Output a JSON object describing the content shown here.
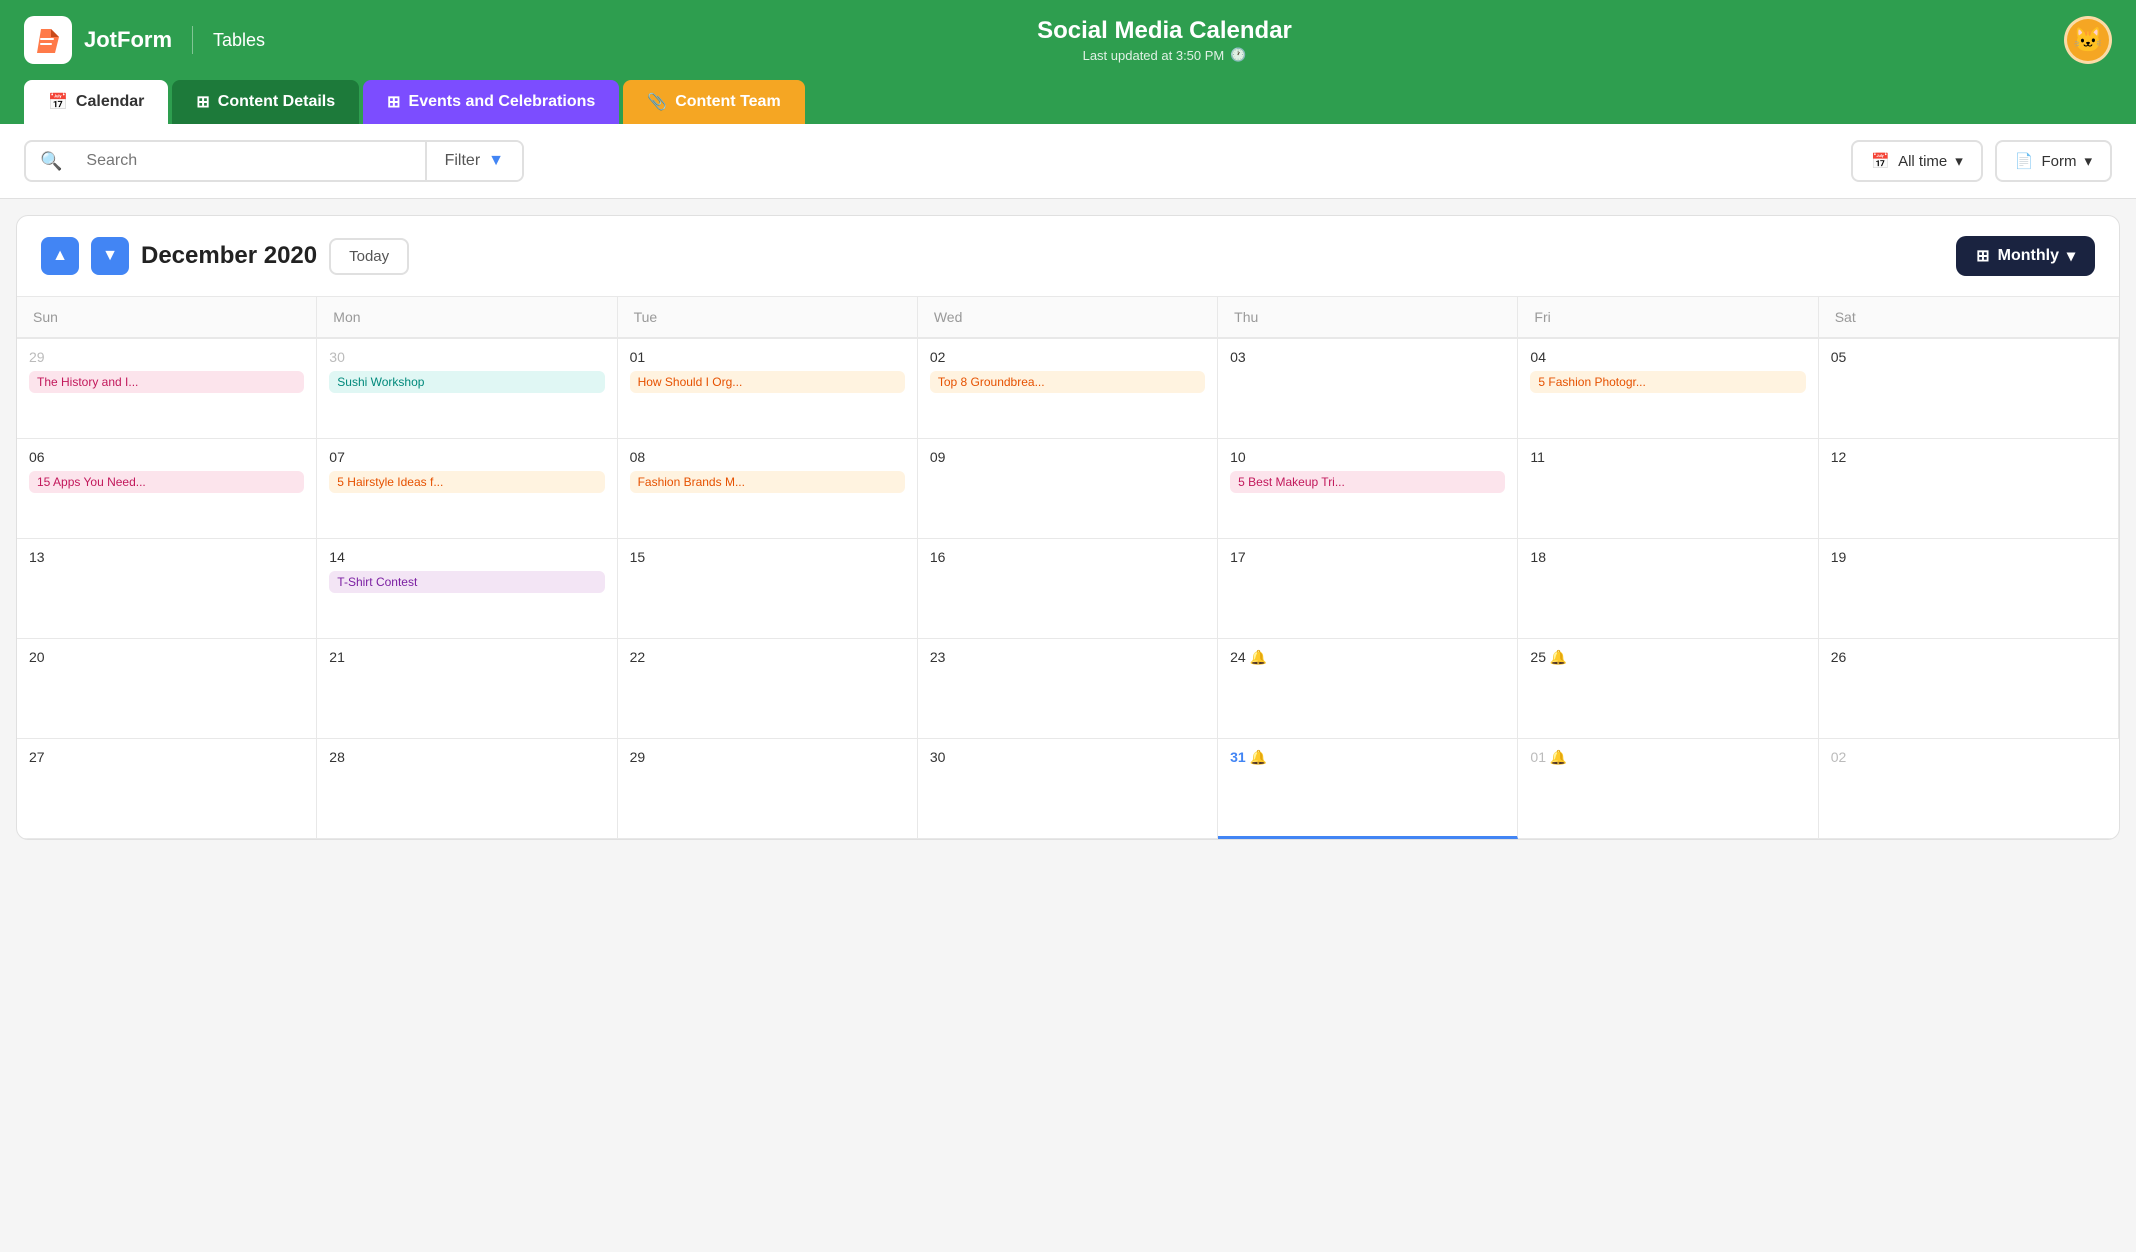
{
  "header": {
    "logo_text": "JotForm",
    "tables_label": "Tables",
    "title": "Social Media Calendar",
    "subtitle": "Last updated at 3:50 PM",
    "avatar_emoji": "🐱"
  },
  "tabs": [
    {
      "id": "calendar",
      "label": "Calendar",
      "icon": "📅",
      "active": true
    },
    {
      "id": "content-details",
      "label": "Content Details",
      "icon": "📊",
      "active": false
    },
    {
      "id": "events",
      "label": "Events and Celebrations",
      "icon": "📊",
      "active": false
    },
    {
      "id": "content-team",
      "label": "Content Team",
      "icon": "📎",
      "active": false
    }
  ],
  "toolbar": {
    "search_placeholder": "Search",
    "filter_label": "Filter",
    "all_time_label": "All time",
    "form_label": "Form"
  },
  "calendar": {
    "prev_label": "▲",
    "next_label": "▼",
    "month_title": "December 2020",
    "today_label": "Today",
    "view_label": "Monthly",
    "day_headers": [
      "Sun",
      "Mon",
      "Tue",
      "Wed",
      "Thu",
      "Fri",
      "Sat"
    ],
    "weeks": [
      [
        {
          "num": "29",
          "muted": true,
          "events": [
            {
              "label": "The History and I...",
              "style": "pink"
            }
          ]
        },
        {
          "num": "30",
          "muted": true,
          "events": [
            {
              "label": "Sushi Workshop",
              "style": "teal"
            }
          ]
        },
        {
          "num": "01",
          "events": [
            {
              "label": "How Should I Org...",
              "style": "orange"
            }
          ]
        },
        {
          "num": "02",
          "events": [
            {
              "label": "Top 8 Groundbrea...",
              "style": "orange"
            }
          ]
        },
        {
          "num": "03",
          "events": []
        },
        {
          "num": "04",
          "events": [
            {
              "label": "5 Fashion Photogr...",
              "style": "orange"
            }
          ]
        },
        {
          "num": "05",
          "events": []
        }
      ],
      [
        {
          "num": "06",
          "events": [
            {
              "label": "15 Apps You Need...",
              "style": "pink"
            }
          ]
        },
        {
          "num": "07",
          "events": [
            {
              "label": "5 Hairstyle Ideas f...",
              "style": "orange"
            }
          ]
        },
        {
          "num": "08",
          "events": [
            {
              "label": "Fashion Brands M...",
              "style": "orange"
            }
          ]
        },
        {
          "num": "09",
          "events": []
        },
        {
          "num": "10",
          "events": [
            {
              "label": "5 Best Makeup Tri...",
              "style": "pink"
            }
          ]
        },
        {
          "num": "11",
          "events": []
        },
        {
          "num": "12",
          "events": []
        }
      ],
      [
        {
          "num": "13",
          "events": []
        },
        {
          "num": "14",
          "events": [
            {
              "label": "T-Shirt Contest",
              "style": "purple"
            }
          ]
        },
        {
          "num": "15",
          "events": []
        },
        {
          "num": "16",
          "events": []
        },
        {
          "num": "17",
          "events": []
        },
        {
          "num": "18",
          "events": []
        },
        {
          "num": "19",
          "events": []
        }
      ],
      [
        {
          "num": "20",
          "events": []
        },
        {
          "num": "21",
          "events": []
        },
        {
          "num": "22",
          "events": []
        },
        {
          "num": "23",
          "events": []
        },
        {
          "num": "24",
          "bell": true,
          "events": []
        },
        {
          "num": "25",
          "bell": true,
          "events": []
        },
        {
          "num": "26",
          "events": []
        }
      ],
      [
        {
          "num": "27",
          "events": []
        },
        {
          "num": "28",
          "events": []
        },
        {
          "num": "29",
          "events": []
        },
        {
          "num": "30",
          "events": []
        },
        {
          "num": "31",
          "today": true,
          "bell": true,
          "events": []
        },
        {
          "num": "01",
          "muted": true,
          "bell": true,
          "events": []
        },
        {
          "num": "02",
          "muted": true,
          "events": []
        }
      ]
    ]
  }
}
